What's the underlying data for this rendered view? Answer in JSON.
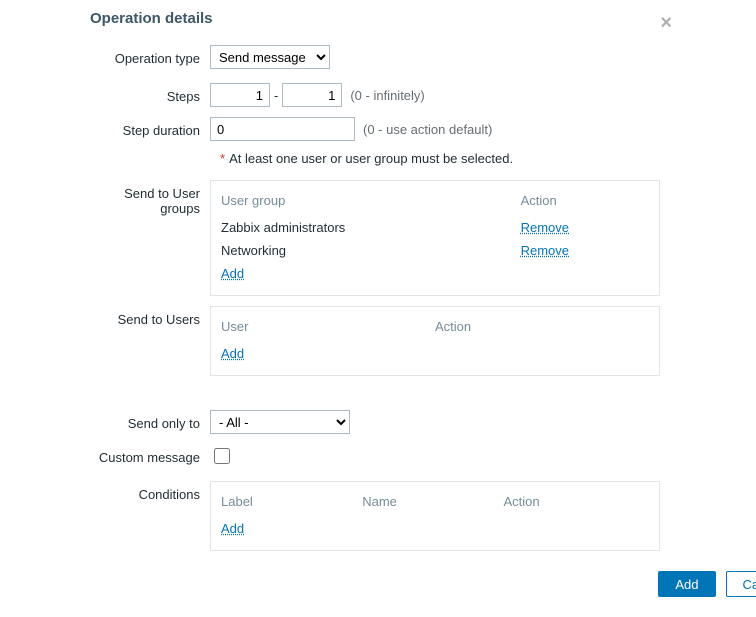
{
  "title": "Operation details",
  "labels": {
    "operation_type": "Operation type",
    "steps": "Steps",
    "step_duration": "Step duration",
    "send_to_user_groups": "Send to User groups",
    "send_to_users": "Send to Users",
    "send_only_to": "Send only to",
    "custom_message": "Custom message",
    "conditions": "Conditions"
  },
  "operation_type": {
    "selected": "Send message"
  },
  "steps": {
    "from": "1",
    "to": "1",
    "hint": "(0 - infinitely)"
  },
  "step_duration": {
    "value": "0",
    "hint": "(0 - use action default)"
  },
  "required_note": "At least one user or user group must be selected.",
  "user_groups": {
    "headers": {
      "name": "User group",
      "action": "Action"
    },
    "rows": [
      {
        "name": "Zabbix administrators",
        "action": "Remove"
      },
      {
        "name": "Networking",
        "action": "Remove"
      }
    ],
    "add": "Add"
  },
  "users": {
    "headers": {
      "name": "User",
      "action": "Action"
    },
    "add": "Add"
  },
  "send_only_to": {
    "selected": "- All -"
  },
  "custom_message": {
    "checked": false
  },
  "conditions": {
    "headers": {
      "label": "Label",
      "name": "Name",
      "action": "Action"
    },
    "add": "Add"
  },
  "footer": {
    "add": "Add",
    "cancel": "Cancel"
  }
}
